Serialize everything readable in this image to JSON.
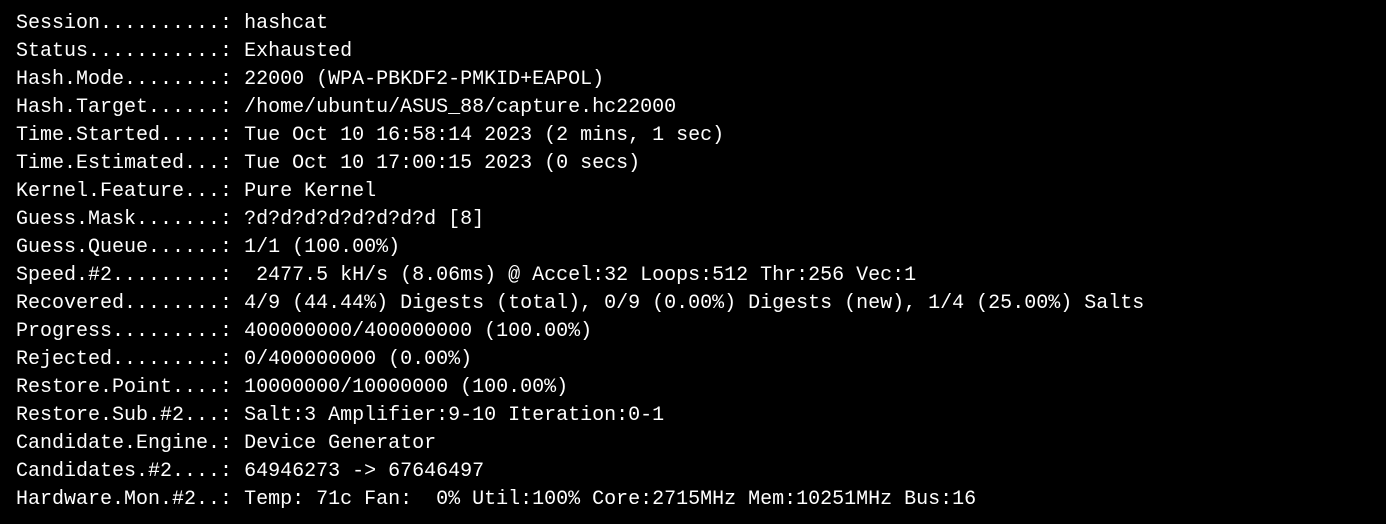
{
  "rows": [
    {
      "label": "Session..........:",
      "value": "hashcat"
    },
    {
      "label": "Status...........:",
      "value": "Exhausted"
    },
    {
      "label": "Hash.Mode........:",
      "value": "22000 (WPA-PBKDF2-PMKID+EAPOL)"
    },
    {
      "label": "Hash.Target......:",
      "value": "/home/ubuntu/ASUS_88/capture.hc22000"
    },
    {
      "label": "Time.Started.....:",
      "value": "Tue Oct 10 16:58:14 2023 (2 mins, 1 sec)"
    },
    {
      "label": "Time.Estimated...:",
      "value": "Tue Oct 10 17:00:15 2023 (0 secs)"
    },
    {
      "label": "Kernel.Feature...:",
      "value": "Pure Kernel"
    },
    {
      "label": "Guess.Mask.......:",
      "value": "?d?d?d?d?d?d?d?d [8]"
    },
    {
      "label": "Guess.Queue......:",
      "value": "1/1 (100.00%)"
    },
    {
      "label": "Speed.#2.........:",
      "value": " 2477.5 kH/s (8.06ms) @ Accel:32 Loops:512 Thr:256 Vec:1"
    },
    {
      "label": "Recovered........:",
      "value": "4/9 (44.44%) Digests (total), 0/9 (0.00%) Digests (new), 1/4 (25.00%) Salts"
    },
    {
      "label": "Progress.........:",
      "value": "400000000/400000000 (100.00%)"
    },
    {
      "label": "Rejected.........:",
      "value": "0/400000000 (0.00%)"
    },
    {
      "label": "Restore.Point....:",
      "value": "10000000/10000000 (100.00%)"
    },
    {
      "label": "Restore.Sub.#2...:",
      "value": "Salt:3 Amplifier:9-10 Iteration:0-1"
    },
    {
      "label": "Candidate.Engine.:",
      "value": "Device Generator"
    },
    {
      "label": "Candidates.#2....:",
      "value": "64946273 -> 67646497"
    },
    {
      "label": "Hardware.Mon.#2..:",
      "value": "Temp: 71c Fan:  0% Util:100% Core:2715MHz Mem:10251MHz Bus:16"
    }
  ]
}
